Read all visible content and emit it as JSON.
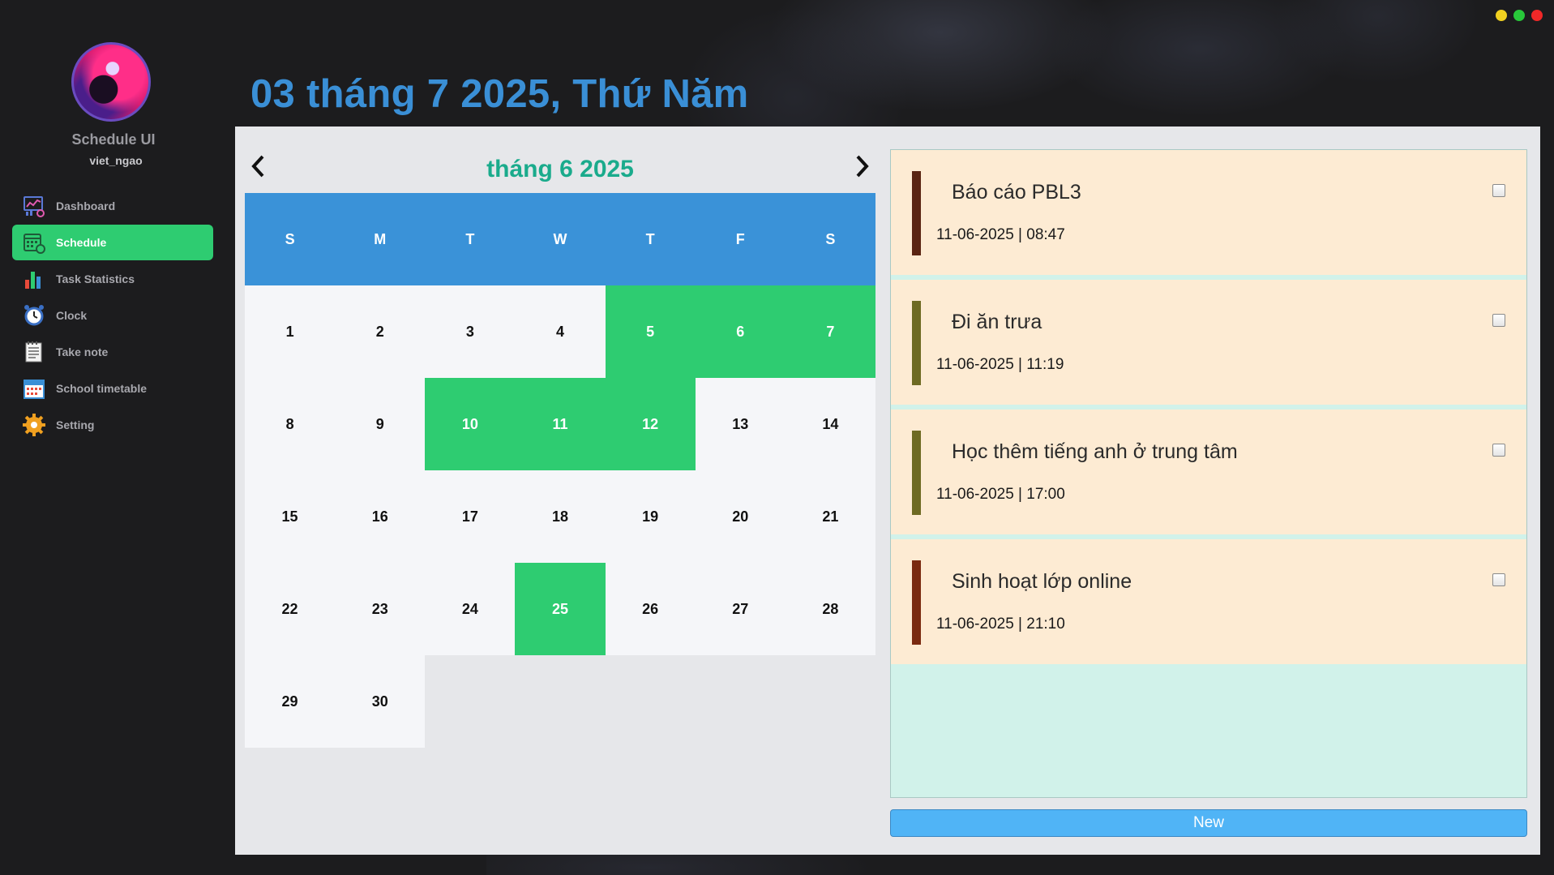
{
  "window": {
    "controls": [
      {
        "name": "minimize",
        "color": "#f0d020"
      },
      {
        "name": "maximize",
        "color": "#28c83a"
      },
      {
        "name": "close",
        "color": "#f02828"
      }
    ]
  },
  "sidebar": {
    "app_name": "Schedule UI",
    "user_name": "viet_ngao",
    "items": [
      {
        "label": "Dashboard",
        "icon": "dashboard-icon",
        "active": false
      },
      {
        "label": "Schedule",
        "icon": "calendar-icon",
        "active": true
      },
      {
        "label": "Task Statistics",
        "icon": "bar-chart-icon",
        "active": false
      },
      {
        "label": "Clock",
        "icon": "alarm-clock-icon",
        "active": false
      },
      {
        "label": "Take note",
        "icon": "notepad-icon",
        "active": false
      },
      {
        "label": "School timetable",
        "icon": "timetable-icon",
        "active": false
      },
      {
        "label": "Setting",
        "icon": "gear-icon",
        "active": false
      }
    ]
  },
  "header": {
    "title": "03 tháng 7 2025, Thứ Năm"
  },
  "calendar": {
    "month_label": "tháng 6 2025",
    "prev_icon": "chevron-left-icon",
    "next_icon": "chevron-right-icon",
    "weekdays": [
      "S",
      "M",
      "T",
      "W",
      "T",
      "F",
      "S"
    ],
    "leading_blanks": 0,
    "days": [
      "1",
      "2",
      "3",
      "4",
      "5",
      "6",
      "7",
      "8",
      "9",
      "10",
      "11",
      "12",
      "13",
      "14",
      "15",
      "16",
      "17",
      "18",
      "19",
      "20",
      "21",
      "22",
      "23",
      "24",
      "25",
      "26",
      "27",
      "28",
      "29",
      "30"
    ],
    "highlighted_days": [
      "5",
      "6",
      "7",
      "10",
      "11",
      "12",
      "25"
    ],
    "highlight_color": "#2ecc71",
    "header_color": "#3a92d8"
  },
  "tasks": {
    "items": [
      {
        "title": "Báo cáo PBL3",
        "time": "11-06-2025 | 08:47",
        "color": "#5a2412",
        "done": false
      },
      {
        "title": "Đi ăn trưa",
        "time": "11-06-2025 | 11:19",
        "color": "#6e6a22",
        "done": false
      },
      {
        "title": "Học thêm tiếng anh ở trung tâm",
        "time": "11-06-2025 | 17:00",
        "color": "#6e6a22",
        "done": false
      },
      {
        "title": "Sinh hoạt lớp online",
        "time": "11-06-2025 | 21:10",
        "color": "#7a2a10",
        "done": false
      }
    ],
    "new_button_label": "New"
  }
}
